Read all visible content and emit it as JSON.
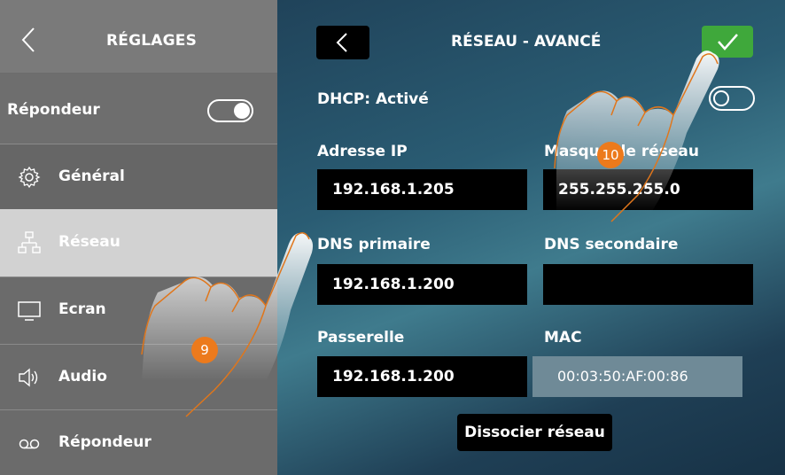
{
  "sidebar": {
    "title": "RÉGLAGES",
    "answering_toggle_label": "Répondeur",
    "items": [
      {
        "label": "Général",
        "icon": "gear-icon"
      },
      {
        "label": "Réseau",
        "icon": "network-icon"
      },
      {
        "label": "Ecran",
        "icon": "monitor-icon"
      },
      {
        "label": "Audio",
        "icon": "speaker-icon"
      },
      {
        "label": "Répondeur",
        "icon": "voicemail-icon"
      }
    ],
    "selected": "Réseau"
  },
  "main": {
    "title": "RÉSEAU - AVANCÉ",
    "dhcp_label": "DHCP: Activé",
    "fields": {
      "ip": {
        "label": "Adresse IP",
        "value": "192.168.1.205"
      },
      "mask": {
        "label": "Masque de réseau",
        "value": "255.255.255.0"
      },
      "dns1": {
        "label": "DNS primaire",
        "value": "192.168.1.200"
      },
      "dns2": {
        "label": "DNS secondaire",
        "value": ""
      },
      "gateway": {
        "label": "Passerelle",
        "value": "192.168.1.200"
      },
      "mac": {
        "label": "MAC",
        "value": "00:03:50:AF:00:86"
      }
    },
    "dissociate_label": "Dissocier réseau"
  },
  "callouts": {
    "one": "9",
    "two": "10"
  },
  "colors": {
    "ok_green": "#3fa83b",
    "callout_orange": "#ec7a1c",
    "selected_row": "#d2d2d2"
  }
}
